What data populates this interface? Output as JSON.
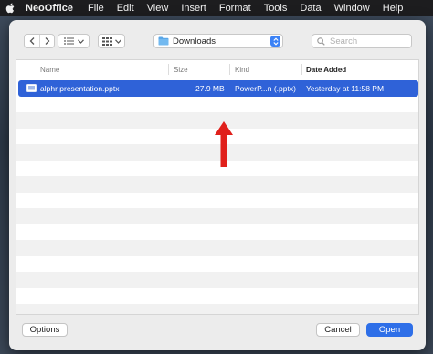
{
  "menubar": {
    "app_name": "NeoOffice",
    "items": [
      "File",
      "Edit",
      "View",
      "Insert",
      "Format",
      "Tools",
      "Data",
      "Window",
      "Help"
    ]
  },
  "toolbar": {
    "location": "Downloads",
    "search_placeholder": "Search"
  },
  "columns": {
    "name": "Name",
    "size": "Size",
    "kind": "Kind",
    "date_added": "Date Added"
  },
  "files": [
    {
      "name": "alphr presentation.pptx",
      "size": "27.9 MB",
      "kind": "PowerP...n (.pptx)",
      "date_added": "Yesterday at 11:58 PM",
      "selected": true
    }
  ],
  "buttons": {
    "options": "Options",
    "cancel": "Cancel",
    "open": "Open"
  },
  "colors": {
    "accent": "#2f62d8",
    "annotation_arrow": "#e0201b"
  }
}
